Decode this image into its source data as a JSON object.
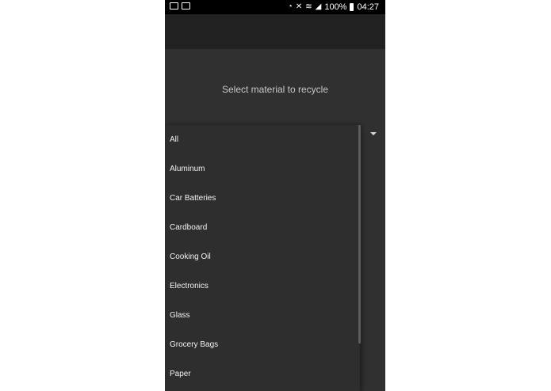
{
  "status_bar": {
    "left_icons": [
      "mail-icon",
      "image-icon"
    ],
    "right_icons": [
      "data-saver-icon",
      "mute-icon",
      "wifi-icon",
      "signal-icon",
      "battery-icon"
    ],
    "battery": "100%",
    "time": "04:27"
  },
  "main": {
    "prompt": "Select material to recycle"
  },
  "dropdown": {
    "items": [
      "All",
      "Aluminum",
      "Car Batteries",
      "Cardboard",
      "Cooking Oil",
      "Electronics",
      "Glass",
      "Grocery Bags",
      "Paper"
    ]
  }
}
